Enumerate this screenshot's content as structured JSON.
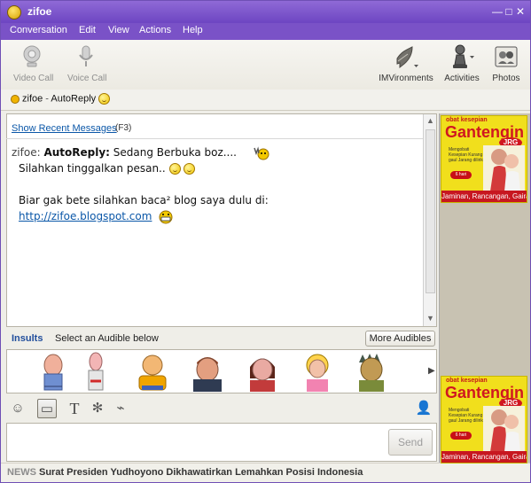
{
  "window": {
    "title": "zifoe",
    "minimize_glyph": "—",
    "maximize_glyph": "□",
    "close_glyph": "✕"
  },
  "menu": [
    "Conversation",
    "Edit",
    "View",
    "Actions",
    "Help"
  ],
  "toolbar": {
    "left_tools": [
      {
        "label": "Video Call",
        "icon": "camera-icon",
        "enabled": false
      },
      {
        "label": "Voice Call",
        "icon": "microphone-icon",
        "enabled": false
      }
    ],
    "right_tools": [
      {
        "label": "IMVironments",
        "icon": "imvironments-icon",
        "enabled": true
      },
      {
        "label": "Activities",
        "icon": "chess-pawn-icon",
        "enabled": true
      },
      {
        "label": "Photos",
        "icon": "photos-icon",
        "enabled": true
      }
    ]
  },
  "status": {
    "name": "zifoe",
    "separator": " - ",
    "mode": "AutoReply"
  },
  "chat": {
    "recent_link": "Show Recent Messages",
    "recent_shortcut": "(F3)",
    "speaker": "zifoe:",
    "autoreply_label": "AutoReply:",
    "line1": "Sedang Berbuka boz....",
    "line2": "Silahkan tinggalkan pesan..",
    "line3": "Biar gak bete silahkan baca² blog saya dulu di:",
    "link": "http://zifoe.blogspot.com"
  },
  "audibles": {
    "category": "Insults",
    "instruction": "Select an Audible below",
    "more_button": "More Audibles",
    "characters": [
      "audible-1",
      "audible-2",
      "audible-3",
      "audible-4",
      "audible-5",
      "audible-6",
      "audible-7"
    ]
  },
  "compose": {
    "send_label": "Send"
  },
  "news": {
    "label": "NEWS",
    "headline": "Surat Presiden Yudhoyono Dikhawatirkan Lemahkan Posisi Indonesia"
  },
  "ads": {
    "small_text": "obat kesepian",
    "title": "Gantengin",
    "badge": "JRG",
    "note": "Mengobati Kesepian Kurang gaul Jarang dilirik",
    "pill": "6 hari",
    "bottom_text": "Jaminan, Rancangan, Gairah"
  },
  "colors": {
    "title_purple": "#6d45c2",
    "menu_purple": "#7a52c7",
    "link_blue": "#0b57a8",
    "ad_yellow": "#f1df1c",
    "ad_red": "#d01720"
  }
}
